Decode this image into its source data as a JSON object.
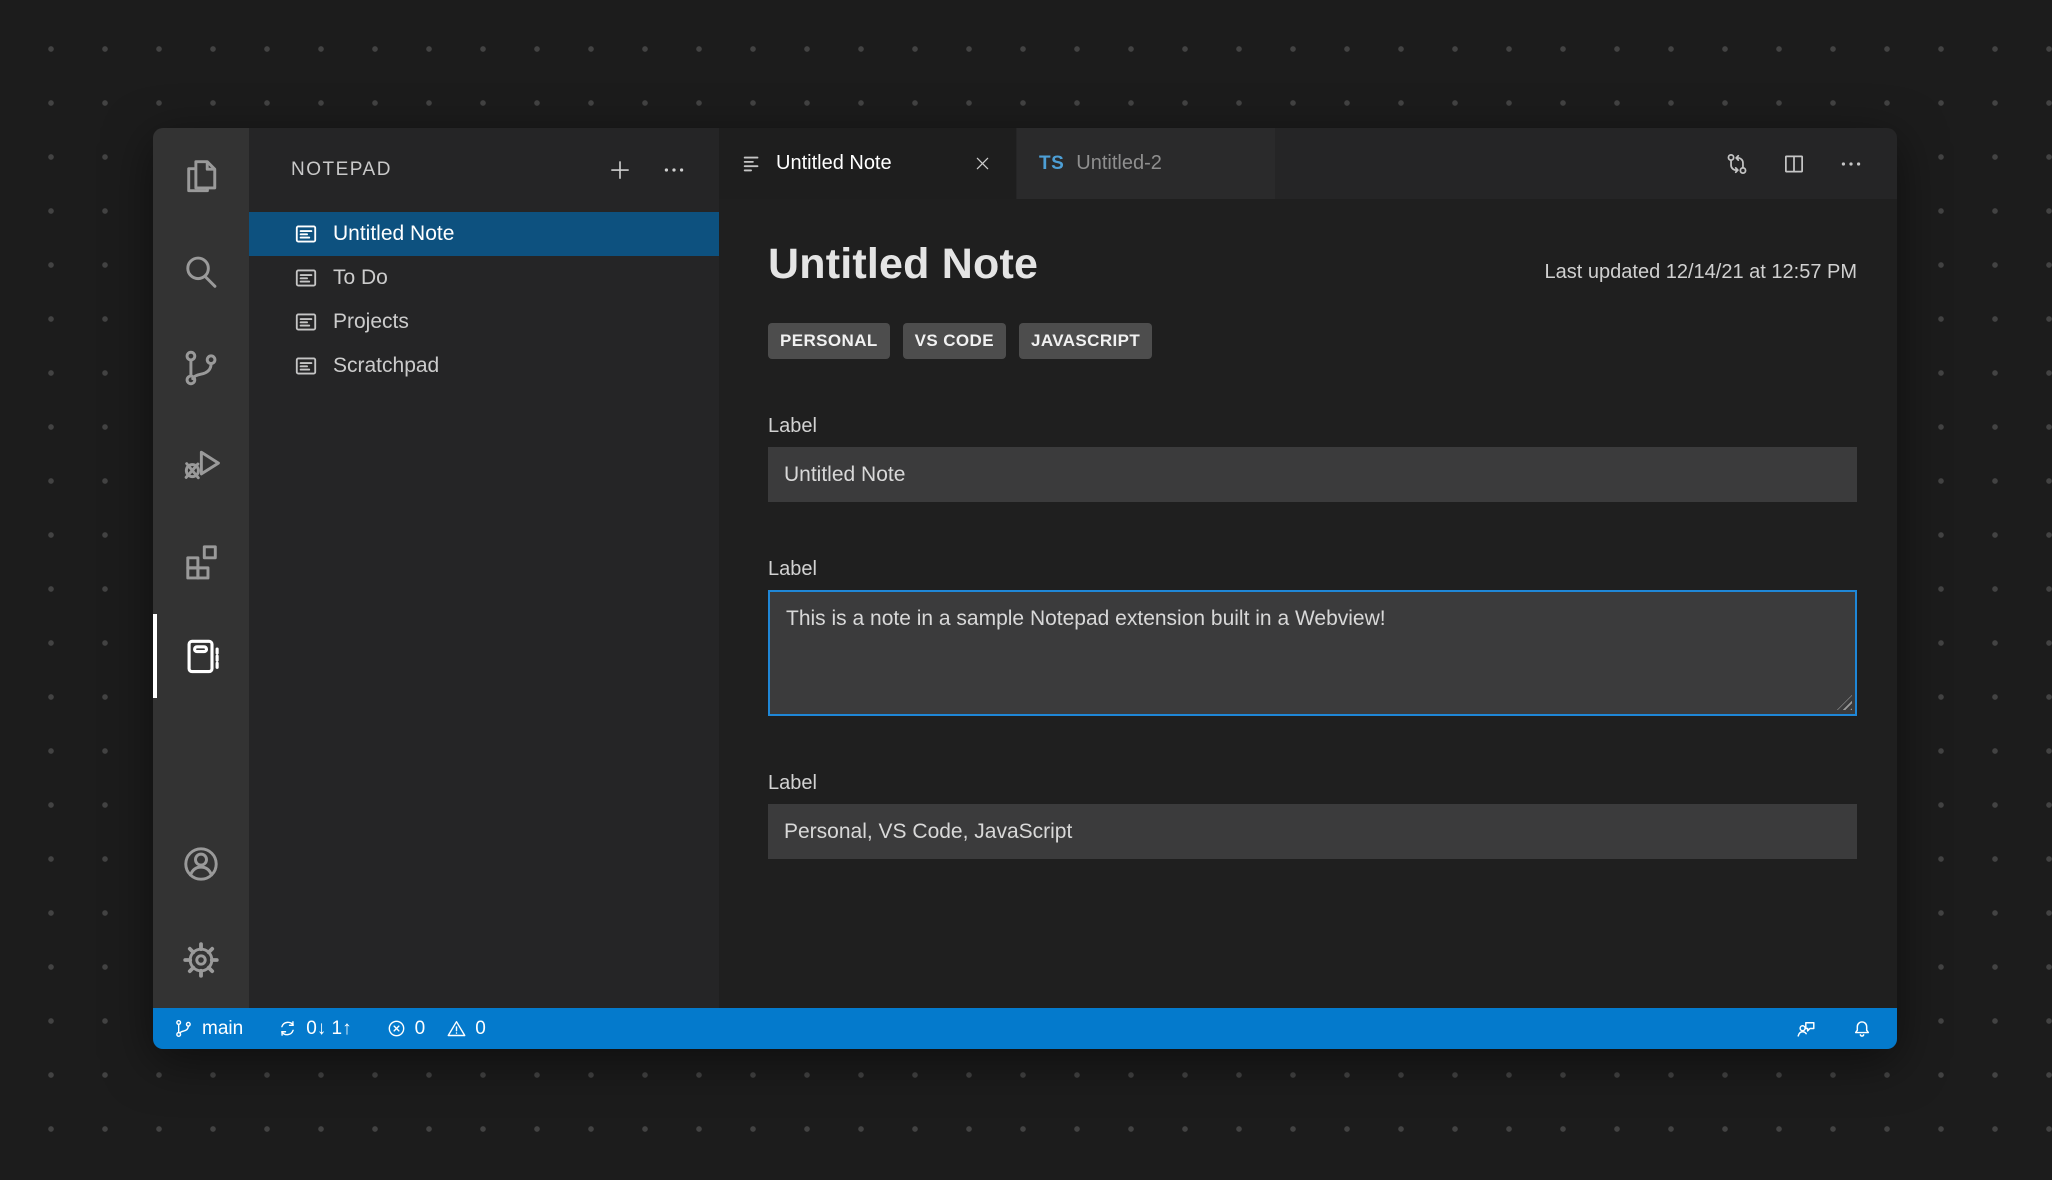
{
  "activity_bar": {
    "items": [
      {
        "icon": "files-icon"
      },
      {
        "icon": "search-icon"
      },
      {
        "icon": "source-control-icon"
      },
      {
        "icon": "run-debug-icon"
      },
      {
        "icon": "extensions-icon"
      },
      {
        "icon": "notepad-icon",
        "active": true
      }
    ],
    "footer": [
      {
        "icon": "account-icon"
      },
      {
        "icon": "settings-gear-icon"
      }
    ]
  },
  "sidebar": {
    "title": "NOTEPAD",
    "actions": {
      "new_note": "+",
      "more": "..."
    },
    "notes": [
      {
        "label": "Untitled Note",
        "selected": true
      },
      {
        "label": "To Do"
      },
      {
        "label": "Projects"
      },
      {
        "label": "Scratchpad"
      }
    ]
  },
  "editor": {
    "tabs": [
      {
        "title": "Untitled Note",
        "active": true
      },
      {
        "badge": "TS",
        "title": "Untitled-2"
      }
    ],
    "note": {
      "title": "Untitled Note",
      "last_updated": "Last updated 12/14/21 at 12:57 PM",
      "tags": [
        "PERSONAL",
        "VS CODE",
        "JAVASCRIPT"
      ],
      "fields": [
        {
          "label": "Label",
          "value": "Untitled Note"
        },
        {
          "label": "Label",
          "value": "This is a note in a sample Notepad extension built in a Webview!"
        },
        {
          "label": "Label",
          "value": "Personal, VS Code, JavaScript"
        }
      ]
    }
  },
  "status_bar": {
    "branch": "main",
    "sync": "0↓ 1↑",
    "errors": "0",
    "warnings": "0"
  },
  "colors": {
    "status_bar": "#047acc",
    "selection": "#0d517f",
    "focus_border": "#1f87d7",
    "ts_blue": "#4d9fd6",
    "activity_bar": "#333333",
    "sidebar": "#252526",
    "editor": "#1f1f1f"
  }
}
